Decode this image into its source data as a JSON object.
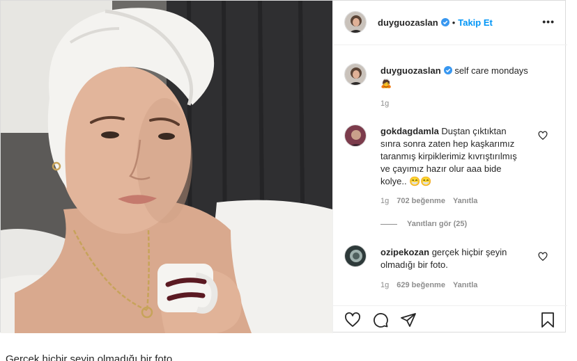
{
  "post": {
    "header": {
      "username": "duyguozaslan",
      "separator": "•",
      "follow_label": "Takip Et",
      "more_label": "•••"
    },
    "caption": {
      "username": "duyguozaslan",
      "text": "self care mondays",
      "emoji": "🙇",
      "time": "1g"
    },
    "comments": [
      {
        "username": "gokdagdamla",
        "text": "Duştan çıktıktan sınra sonra zaten hep kaşkarımız taranmış kirpiklerimiz kıvrıştırılmış ve çayımız hazır olur aaa bide kolye.. 😁😁",
        "time": "1g",
        "likes": "702 beğenme",
        "reply_label": "Yanıtla",
        "view_replies": "Yanıtları gör (25)"
      },
      {
        "username": "ozipekozan",
        "text": "gerçek hiçbir şeyin olmadığı bir foto.",
        "time": "1g",
        "likes": "629 beğenme",
        "reply_label": "Yanıtla"
      }
    ],
    "action_icons": [
      "heart-icon",
      "comment-icon",
      "share-icon",
      "bookmark-icon"
    ]
  },
  "page_caption": "Gerçek hiçbir şeyin olmadığı bir foto.",
  "colors": {
    "link": "#0095f6",
    "muted": "#8e8e8e",
    "text": "#262626",
    "border": "#dbdbdb"
  }
}
